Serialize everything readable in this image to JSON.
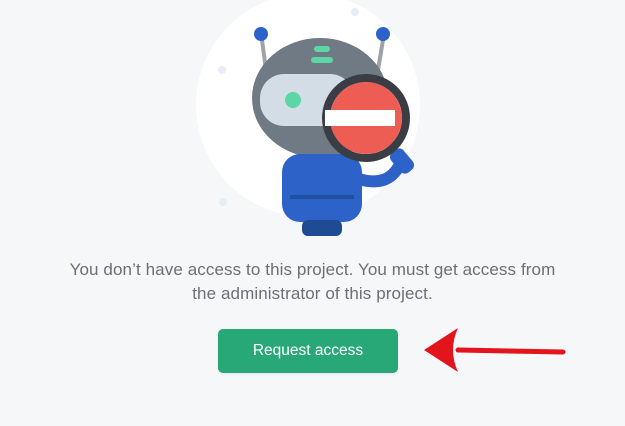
{
  "message": {
    "line1": "You don’t have access to this project. You must get access from",
    "line2": "the administrator of this project."
  },
  "actions": {
    "request_access_label": "Request access"
  },
  "illustration": {
    "robot_icon": "robot-no-access-icon",
    "prohibited_icon": "no-entry-icon"
  },
  "annotation": {
    "arrow_icon": "red-arrow-left-icon",
    "arrow_color": "#e3141b"
  },
  "colors": {
    "background": "#f6f7f9",
    "button": "#27a876",
    "text": "#6b6f76"
  }
}
